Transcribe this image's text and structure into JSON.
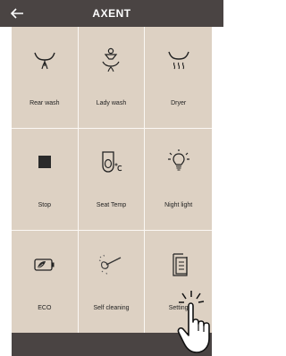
{
  "header": {
    "title": "AXENT",
    "back_icon": "arrow-left-icon"
  },
  "tiles": [
    {
      "label": "Rear wash",
      "icon": "rear-wash-icon"
    },
    {
      "label": "Lady wash",
      "icon": "lady-wash-icon"
    },
    {
      "label": "Dryer",
      "icon": "dryer-icon"
    },
    {
      "label": "Stop",
      "icon": "stop-icon"
    },
    {
      "label": "Seat Temp",
      "icon": "seat-temp-icon"
    },
    {
      "label": "Night light",
      "icon": "night-light-icon"
    },
    {
      "label": "ECO",
      "icon": "eco-battery-icon"
    },
    {
      "label": "Self cleaning",
      "icon": "self-cleaning-icon"
    },
    {
      "label": "Setting",
      "icon": "settings-icon"
    }
  ],
  "colors": {
    "bar": "#4a4443",
    "panel": "#ddd1c3",
    "divider": "#fbf8f4"
  }
}
